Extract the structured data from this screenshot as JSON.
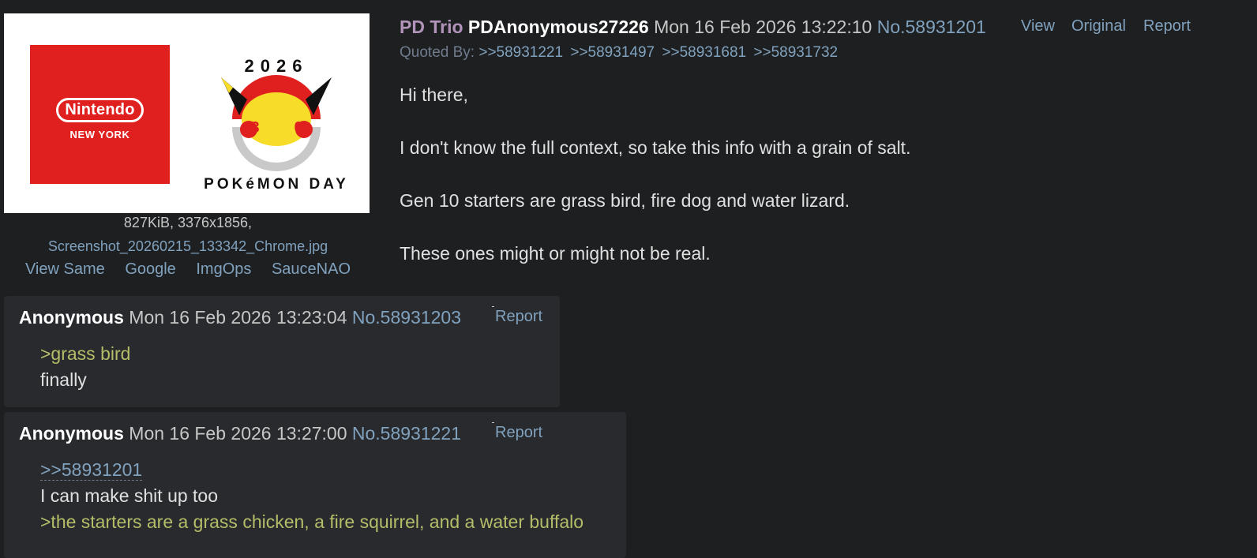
{
  "op": {
    "thumbnail": {
      "left_brand": "Nintendo",
      "left_sub": "NEW YORK",
      "right_logo": "pokemon-day-2026-30-logo"
    },
    "file": {
      "size_dims": "827KiB, 3376x1856,",
      "filename": "Screenshot_20260215_133342_Chrome.jpg",
      "links": [
        "View Same",
        "Google",
        "ImgOps",
        "SauceNAO"
      ]
    },
    "trip": "PD Trio",
    "name": "PDAnonymous27226",
    "date": "Mon 16 Feb 2026 13:22:10",
    "post_no": "No.58931201",
    "actions": {
      "view": "View",
      "original": "Original",
      "report": "Report"
    },
    "quoted_by_label": "Quoted By:",
    "quoted_by": [
      ">>58931221",
      ">>58931497",
      ">>58931681",
      ">>58931732"
    ],
    "body": [
      "Hi there,",
      "I don't know the full context, so take this info with a grain of salt.",
      "Gen 10 starters are grass bird, fire dog and water lizard.",
      "These ones might or might not be real."
    ]
  },
  "replies": [
    {
      "name": "Anonymous",
      "date": "Mon 16 Feb 2026 13:23:04",
      "post_no": "No.58931203",
      "report": "Report",
      "lines": [
        {
          "type": "greentext",
          "text": ">grass bird"
        },
        {
          "type": "text",
          "text": "finally"
        }
      ]
    },
    {
      "name": "Anonymous",
      "date": "Mon 16 Feb 2026 13:27:00",
      "post_no": "No.58931221",
      "report": "Report",
      "lines": [
        {
          "type": "quotelink",
          "text": ">>58931201"
        },
        {
          "type": "text",
          "text": "I can make shit up too"
        },
        {
          "type": "greentext",
          "text": ">the starters are a grass chicken, a fire squirrel, and a water buffalo"
        }
      ]
    }
  ],
  "colors": {
    "background": "#1d1f21",
    "reply_bg": "#282a2e",
    "link": "#81a2be",
    "greentext": "#b5bd68",
    "trip": "#b294bb"
  }
}
